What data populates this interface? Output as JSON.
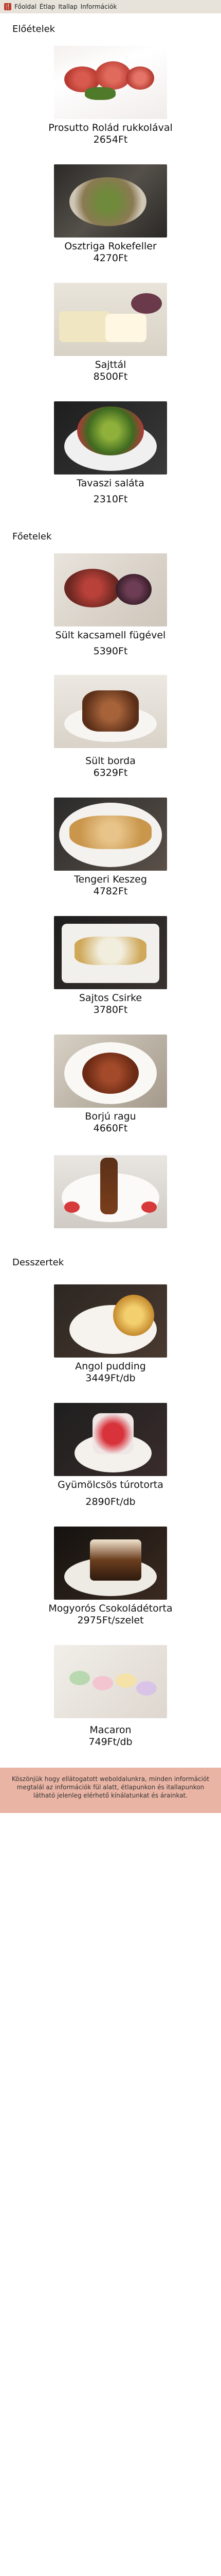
{
  "nav": {
    "logo": "🍴",
    "links": [
      "Főoldal",
      "Étlap",
      "Itallap",
      "Információk"
    ]
  },
  "sections": [
    {
      "title": "Előételek",
      "items": [
        {
          "name": "Prosutto Rolád rukkolával",
          "price": "2654Ft",
          "image": "prosciutto-roll-photo"
        },
        {
          "name": "Osztriga Rokefeller",
          "price": "4270Ft",
          "image": "oyster-rockefeller-photo"
        },
        {
          "name": "Sajttál",
          "price": "8500Ft",
          "image": "cheese-platter-photo"
        },
        {
          "name": "Tavaszi saláta",
          "price": "2310Ft",
          "image": "spring-salad-photo"
        }
      ]
    },
    {
      "title": "Főetelek",
      "items": [
        {
          "name": "Sült kacsamell fügével",
          "price": "5390Ft",
          "image": "duck-breast-photo"
        },
        {
          "name": "Sült borda",
          "price": "6329Ft",
          "image": "roast-rib-photo"
        },
        {
          "name": "Tengeri Keszeg",
          "price": "4782Ft",
          "image": "sea-bream-photo"
        },
        {
          "name": "Sajtos Csirke",
          "price": "3780Ft",
          "image": "cheese-chicken-photo"
        },
        {
          "name": "Borjú ragu",
          "price": "4660Ft",
          "image": "veal-ragout-photo"
        },
        {
          "name": "",
          "price": "",
          "image": "kebab-photo"
        }
      ]
    },
    {
      "title": "Desszertek",
      "items": [
        {
          "name": "Angol pudding",
          "price": "3449Ft/db",
          "image": "pudding-photo"
        },
        {
          "name": "Gyümölcsös túrotorta",
          "price": "2890Ft/db",
          "image": "fruit-cheesecake-photo"
        },
        {
          "name": "Mogyorós Csokoládétorta",
          "price": "2975Ft/szelet",
          "image": "hazelnut-chocolate-cake-photo"
        },
        {
          "name": "Macaron",
          "price": "749Ft/db",
          "image": "macaron-photo"
        }
      ]
    }
  ],
  "footer": {
    "text": "Köszönjük hogy ellátogatott weboldalunkra, minden információt megtalál az információk fül alatt, étlapunkon és itallapunkon látható jelenleg elérhető kínálatunkat és árainkat."
  }
}
